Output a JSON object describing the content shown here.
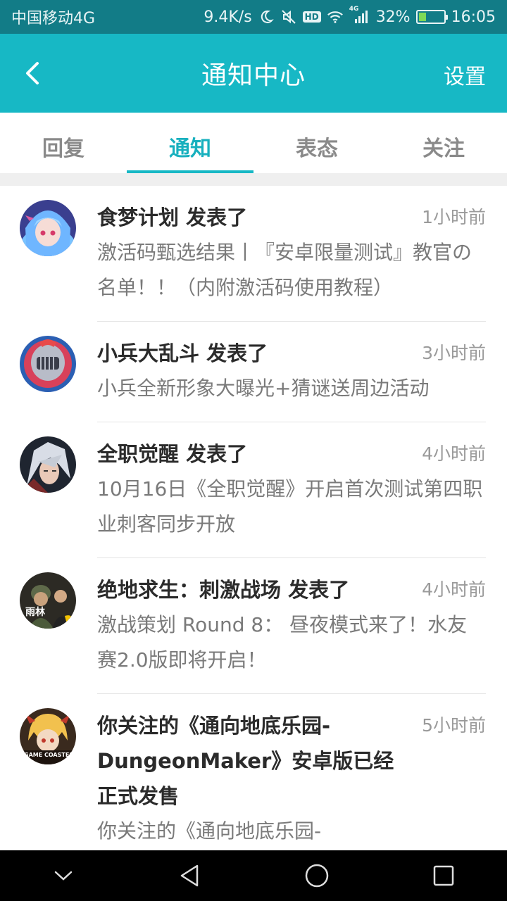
{
  "status_bar": {
    "carrier": "中国移动4G",
    "speed": "9.4K/s",
    "hd_badge": "HD",
    "signal_label": "4G",
    "battery_percent": "32%",
    "battery_level": 0.32,
    "time": "16:05"
  },
  "header": {
    "title": "通知中心",
    "settings_label": "设置"
  },
  "tabs": [
    {
      "label": "回复",
      "active": false
    },
    {
      "label": "通知",
      "active": true
    },
    {
      "label": "表态",
      "active": false
    },
    {
      "label": "关注",
      "active": false
    }
  ],
  "notifications": [
    {
      "title": "食梦计划 发表了",
      "time": "1小时前",
      "desc": "激活码甄选结果丨『安卓限量测试』教官の名单！！（内附激活码使用教程）",
      "avatar": "anime-girl-avatar"
    },
    {
      "title": "小兵大乱斗 发表了",
      "time": "3小时前",
      "desc": "小兵全新形象大曝光+猜谜送周边活动",
      "avatar": "knight-helmet-avatar"
    },
    {
      "title": "全职觉醒 发表了",
      "time": "4小时前",
      "desc": "10月16日《全职觉醒》开启首次测试第四职业刺客同步开放",
      "avatar": "white-hair-warrior-avatar"
    },
    {
      "title": "绝地求生：刺激战场 发表了",
      "time": "4小时前",
      "desc": "激战策划 Round 8： 昼夜模式来了！水友赛2.0版即将开启！",
      "avatar": "soldiers-avatar",
      "avatar_text": "雨林"
    },
    {
      "title": "你关注的《通向地底乐园-DungeonMaker》安卓版已经正式发售",
      "time": "5小时前",
      "desc": "你关注的《通向地底乐园-",
      "avatar": "game-coaster-avatar",
      "avatar_text": "GAME COASTER"
    }
  ]
}
